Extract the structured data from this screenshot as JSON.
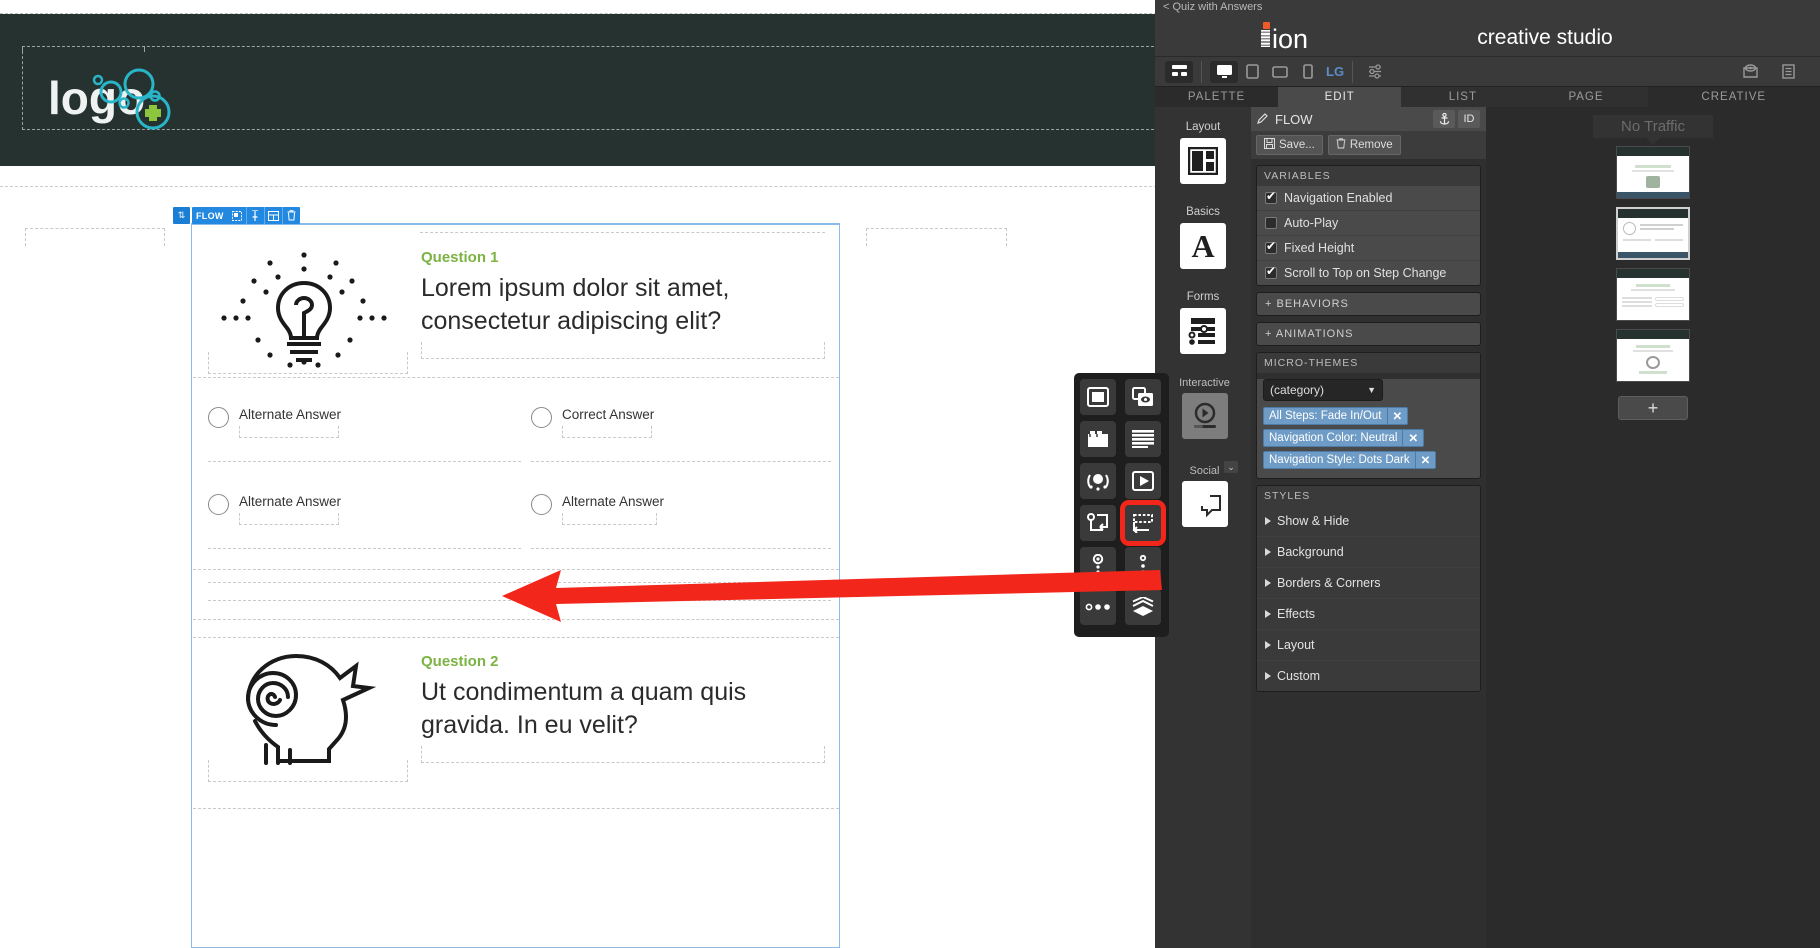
{
  "canvas": {
    "logo": {
      "text": "logo",
      "accent_color": "#29b5c8",
      "plus_color": "#8cc63f",
      "band_color": "#263230"
    },
    "flow_toolbar": {
      "label": "FLOW",
      "icons": [
        "reorder-icon",
        "duplicate-icon",
        "pin-icon",
        "grid-icon",
        "trash-icon"
      ]
    },
    "questions": [
      {
        "eyebrow": "Question 1",
        "title": "Lorem ipsum dolor sit amet, consectetur adipiscing elit?",
        "icon": "lightbulb-dotted-icon",
        "answers": [
          "Alternate Answer",
          "Correct Answer",
          "Alternate Answer",
          "Alternate Answer"
        ]
      },
      {
        "eyebrow": "Question 2",
        "title": "Ut condimentum a quam quis gravida. In eu velit?",
        "icon": "head-spiral-icon",
        "answers": []
      }
    ],
    "eyebrow_color": "#7cb342"
  },
  "app": {
    "breadcrumb": "< Quiz with Answers",
    "brand": "ion",
    "title": "creative studio",
    "device_bar": {
      "icons": [
        "layout-icon",
        "desktop-icon",
        "tablet-icon",
        "tablet-landscape-icon",
        "mobile-icon",
        "settings-sliders-icon"
      ],
      "breakpoint": "LG",
      "right_icons": [
        "preview-eye-icon",
        "notes-icon"
      ]
    },
    "tabs": [
      {
        "label": "PALETTE",
        "state": "plain"
      },
      {
        "label": "EDIT",
        "state": "selected"
      },
      {
        "label": "LIST",
        "state": "normal"
      },
      {
        "label": "PAGE",
        "state": "normal"
      },
      {
        "label": "CREATIVE",
        "state": "plain"
      }
    ],
    "palette": [
      {
        "caption": "Layout",
        "icon": "layout-grid-icon"
      },
      {
        "caption": "Basics",
        "icon": "typography-a-icon"
      },
      {
        "caption": "Forms",
        "icon": "form-controls-icon"
      }
    ],
    "flyout": {
      "icons": [
        "image-frame-icon",
        "gallery-eye-icon",
        "folder-tabs-icon",
        "text-lines-icon",
        "hotspot-icon",
        "video-play-icon",
        "flow-branch-icon",
        "flow-step-icon",
        "target-dots-icon",
        "dots-vertical-icon",
        "dots-row-icon",
        "layers-icon"
      ],
      "highlighted_index": 7,
      "highlight_color": "#f3261b",
      "groups": [
        {
          "caption": "Interactive",
          "icon": "video-player-icon"
        },
        {
          "caption": "Social",
          "icon": "social-chat-icon"
        }
      ]
    },
    "edit": {
      "header_label": "FLOW",
      "header_icon": "pencil-icon",
      "header_buttons": [
        {
          "label": "",
          "icon": "anchor-icon"
        },
        {
          "label": "ID",
          "icon": ""
        }
      ],
      "actions": [
        {
          "label": "Save...",
          "icon": "save-disk-icon"
        },
        {
          "label": "Remove",
          "icon": "trash-icon"
        }
      ],
      "variables_title": "VARIABLES",
      "variables": [
        {
          "label": "Navigation Enabled",
          "checked": true
        },
        {
          "label": "Auto-Play",
          "checked": false
        },
        {
          "label": "Fixed Height",
          "checked": true
        },
        {
          "label": "Scroll to Top on Step Change",
          "checked": true
        }
      ],
      "collapsibles": [
        "+ BEHAVIORS",
        "+ ANIMATIONS"
      ],
      "microthemes_title": "MICRO-THEMES",
      "microthemes_dropdown": "(category)",
      "microthemes": [
        "All Steps: Fade In/Out",
        "Navigation Color: Neutral",
        "Navigation Style: Dots Dark"
      ],
      "tag_close": "✕",
      "styles_title": "STYLES",
      "styles": [
        "Show & Hide",
        "Background",
        "Borders & Corners",
        "Effects",
        "Layout",
        "Custom"
      ]
    },
    "creative": {
      "status": "No Traffic",
      "add_label": "+",
      "thumbnails": [
        {
          "selected": false
        },
        {
          "selected": true
        },
        {
          "selected": false
        },
        {
          "selected": false
        }
      ]
    }
  }
}
